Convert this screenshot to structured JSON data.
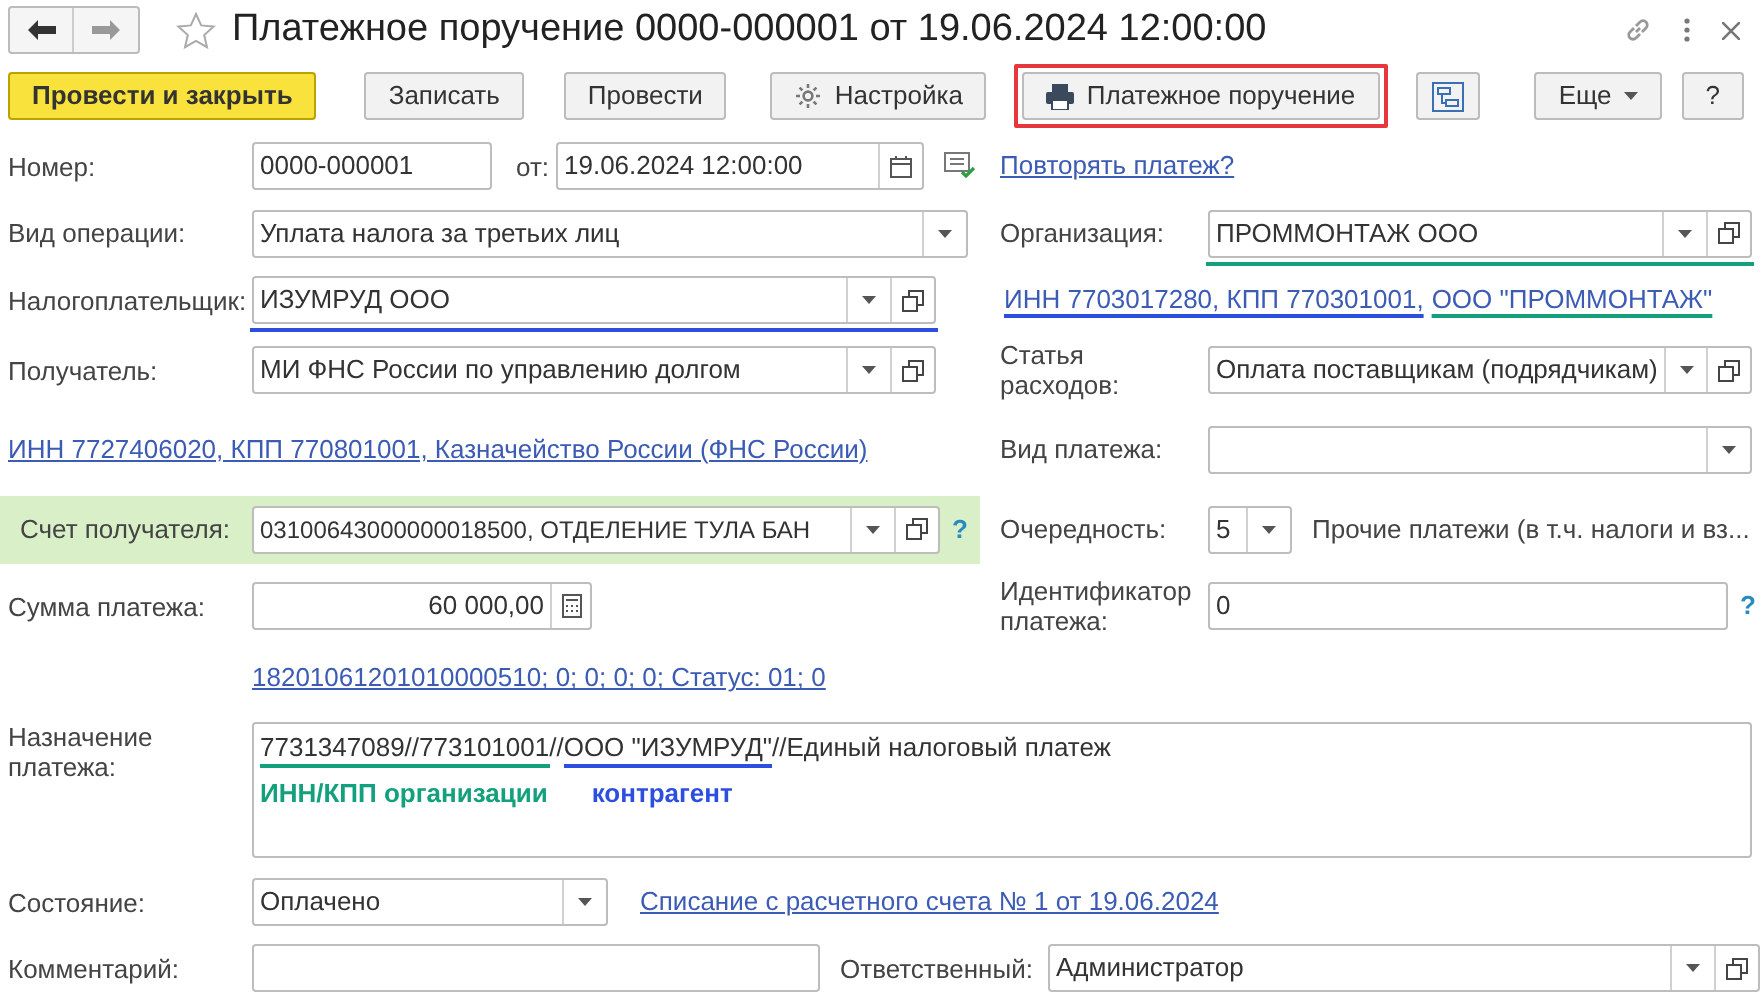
{
  "title": "Платежное поручение 0000-000001 от 19.06.2024 12:00:00",
  "toolbar": [
    {
      "kind": "primary",
      "label": "Провести и закрыть",
      "highlighted": false
    },
    {
      "kind": "plain",
      "label": "Записать",
      "highlighted": false
    },
    {
      "kind": "plain",
      "label": "Провести",
      "highlighted": false
    },
    {
      "kind": "gear",
      "label": "Настройка",
      "highlighted": false
    },
    {
      "kind": "printer",
      "label": "Платежное поручение",
      "highlighted": true
    },
    {
      "kind": "structure",
      "highlighted": false
    },
    {
      "kind": "menu",
      "label": "Еще",
      "highlighted": false
    },
    {
      "kind": "plain",
      "label": "?",
      "highlighted": false
    }
  ],
  "number": {
    "label": "Номер:",
    "value": "0000-000001"
  },
  "date": {
    "label": "от:",
    "value": "19.06.2024 12:00:00"
  },
  "repeat_link": "Повторять платеж?",
  "operation_type": {
    "label": "Вид операции:",
    "value": "Уплата налога за третьих лиц"
  },
  "organization": {
    "label": "Организация:",
    "value": "ПРОММОНТАЖ ООО",
    "color": "#13a07c"
  },
  "taxpayer": {
    "label": "Налогоплательщик:",
    "value": "ИЗУМРУД ООО",
    "color": "#2d4fe0"
  },
  "taxpayer_link": [
    {
      "text": "ИНН 7703017280, КПП 770301001,",
      "color": "#2d4fe0"
    },
    {
      "text": "ООО \"ПРОММОНТАЖ\"",
      "color": "#13a07c"
    }
  ],
  "recipient": {
    "label": "Получатель:",
    "value": "МИ ФНС России по управлению долгом"
  },
  "expense_item": {
    "label": "Статья расходов:",
    "value": "Оплата поставщикам (подрядчикам)"
  },
  "recipient_link": "ИНН 7727406020, КПП 770801001, Казначейство России (ФНС России)",
  "payment_kind": {
    "label": "Вид платежа:"
  },
  "account": {
    "label": "Счет получателя:",
    "value": "03100643000000018500, ОТДЕЛЕНИЕ ТУЛА БАН",
    "highlighted": true,
    "help": "?"
  },
  "priority": {
    "label": "Очередность:",
    "value": "5",
    "description": "Прочие платежи (в т.ч. налоги и вз..."
  },
  "amount": {
    "label": "Сумма платежа:",
    "value": "60 000,00"
  },
  "payment_id": {
    "label": "Идентификатор платежа:",
    "value": "0",
    "help": "?"
  },
  "tax_details_link": "18201061201010000510; 0; 0; 0; 0; Статус: 01; 0",
  "purpose": {
    "label": "Назначение платежа:",
    "segments": [
      {
        "text": "7731347089//773101001",
        "color": "#13a07c"
      },
      {
        "text": "//"
      },
      {
        "text": "ООО \"ИЗУМРУД\"",
        "color": "#2d4fe0"
      },
      {
        "text": "//Единый налоговый платеж"
      }
    ],
    "notes": [
      {
        "text": "ИНН/КПП организации",
        "color": "#13a07c"
      },
      {
        "text": "контрагент",
        "color": "#2d4fe0"
      }
    ]
  },
  "status": {
    "label": "Состояние:",
    "value": "Оплачено"
  },
  "status_link": "Списание с расчетного счета № 1 от 19.06.2024",
  "comment": {
    "label": "Комментарий:"
  },
  "responsible": {
    "label": "Ответственный:",
    "value": "Администратор"
  }
}
